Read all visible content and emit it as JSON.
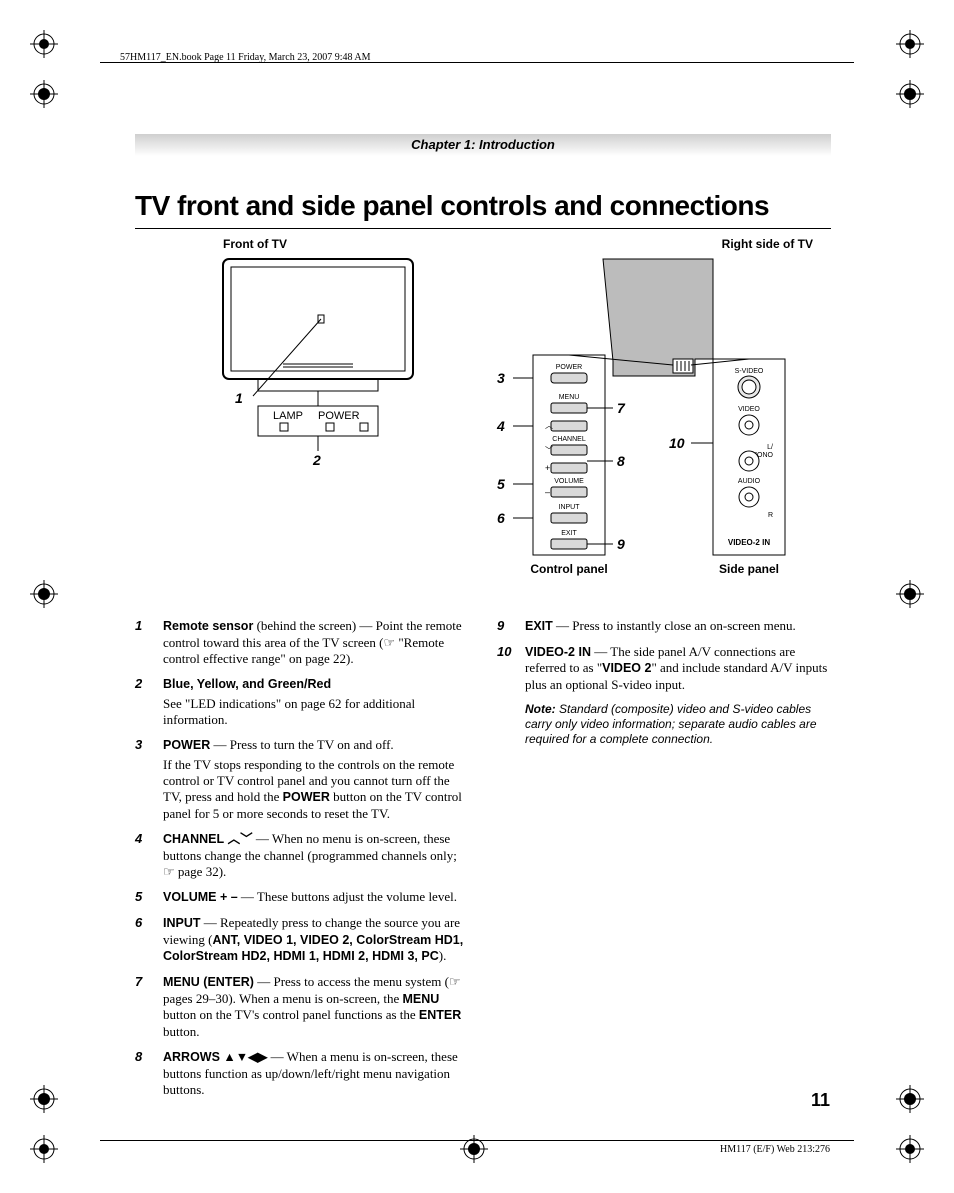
{
  "print_header": "57HM117_EN.book  Page 11  Friday, March 23, 2007  9:48 AM",
  "chapter": "Chapter 1: Introduction",
  "title": "TV front and side panel controls and connections",
  "figures": {
    "front_label": "Front of TV",
    "right_label": "Right side of TV",
    "control_panel_label": "Control panel",
    "side_panel_label": "Side panel",
    "lamp": "LAMP",
    "power": "POWER",
    "panel": {
      "power": "POWER",
      "menu": "MENU",
      "channel": "CHANNEL",
      "volume": "VOLUME",
      "input": "INPUT",
      "exit": "EXIT"
    },
    "side": {
      "svideo": "S-VIDEO",
      "video": "VIDEO",
      "lmono": "L/\nMONO",
      "audio": "AUDIO",
      "r": "R",
      "title": "VIDEO-2 IN"
    },
    "callouts": {
      "c1": "1",
      "c2": "2",
      "c3": "3",
      "c4": "4",
      "c5": "5",
      "c6": "6",
      "c7": "7",
      "c8": "8",
      "c9": "9",
      "c10": "10"
    }
  },
  "items": [
    {
      "n": "1",
      "title": "Remote sensor",
      "title_after": " (behind the screen) — Point the remote control toward this area of the TV screen (☞ \"Remote control effective range\" on page 22)."
    },
    {
      "n": "2",
      "title": "Blue, Yellow, and Green/Red",
      "title_only": true,
      "rest": "See \"LED indications\" on page 62 for additional information."
    },
    {
      "n": "3",
      "title": "POWER",
      "title_after": " — Press to turn the TV on and off.",
      "rest": "If the TV stops responding to the controls on the remote control or TV control panel and you cannot turn off the TV, press and hold the ",
      "rest_bold": "POWER",
      "rest2": " button on the TV control panel for 5 or more seconds to reset the TV."
    },
    {
      "n": "4",
      "title": "CHANNEL",
      "title_glyph": " ︿﹀",
      "title_after": " — When no menu is on-screen, these buttons change the channel (programmed channels only; ☞ page 32)."
    },
    {
      "n": "5",
      "title": "VOLUME + –",
      "title_after": " — These buttons adjust the volume level."
    },
    {
      "n": "6",
      "title": "INPUT",
      "title_after": " — Repeatedly press to change the source you are viewing (",
      "sources": "ANT, VIDEO 1, VIDEO 2, ColorStream HD1, ColorStream HD2, HDMI 1, HDMI 2, HDMI 3, PC",
      "tail": ")."
    },
    {
      "n": "7",
      "title": "MENU (ENTER)",
      "title_after": " — Press to access the menu system (☞ pages 29–30). When a menu is on-screen, the ",
      "mid_bold": "MENU",
      "mid_after": " button on the TV's control panel functions as the ",
      "end_bold": "ENTER",
      "end_after": " button."
    },
    {
      "n": "8",
      "title": "ARROWS",
      "title_glyph": " ▲▼◀▶",
      "title_after": " — When a menu is on-screen, these buttons function as up/down/left/right menu navigation buttons."
    }
  ],
  "items_col2": [
    {
      "n": "9",
      "title": "EXIT",
      "title_after": " — Press to instantly close an on-screen menu."
    },
    {
      "n": "10",
      "title": "VIDEO-2 IN",
      "title_after": " — The side panel A/V connections are referred to as \"",
      "mid_bold": "VIDEO 2",
      "mid_after": "\" and include standard A/V inputs plus an optional S-video input."
    }
  ],
  "note": {
    "label": "Note:",
    "text": " Standard (composite) video and S-video cables carry only video information; separate audio cables are required for a complete connection."
  },
  "page_number": "11",
  "footer_code": "HM117 (E/F) Web 213:276"
}
